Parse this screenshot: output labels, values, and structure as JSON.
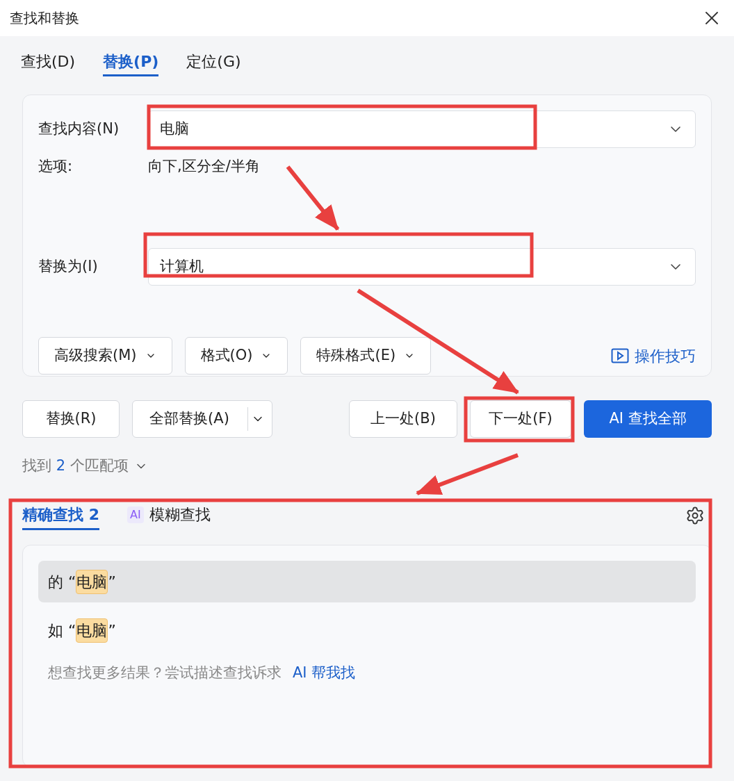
{
  "window": {
    "title": "查找和替换"
  },
  "tabs": [
    {
      "label": "查找(D)",
      "selected": false
    },
    {
      "label": "替换(P)",
      "selected": true
    },
    {
      "label": "定位(G)",
      "selected": false
    }
  ],
  "find": {
    "label": "查找内容(N)",
    "value": "电脑"
  },
  "options": {
    "label": "选项:",
    "value": "向下,区分全/半角"
  },
  "replace": {
    "label": "替换为(I)",
    "value": "计算机"
  },
  "option_buttons": [
    "高级搜索(M)",
    "格式(O)",
    "特殊格式(E)"
  ],
  "tips_link": "操作技巧",
  "actions": {
    "replace": "替换(R)",
    "replace_all": "全部替换(A)",
    "previous": "上一处(B)",
    "next": "下一处(F)",
    "find_all": "AI 查找全部"
  },
  "match_summary": {
    "before": "找到",
    "count": "2",
    "after": "个匹配项"
  },
  "result_tabs": [
    {
      "label": "精确查找",
      "count": "2",
      "selected": true
    },
    {
      "label": "模糊查找",
      "badge": "AI",
      "selected": false
    }
  ],
  "results": [
    {
      "before": "的 “",
      "match": "电脑",
      "after": "”",
      "selected": true
    },
    {
      "before": "如 “",
      "match": "电脑",
      "after": "”",
      "selected": false
    }
  ],
  "hint": {
    "text": "想查找更多结果？尝试描述查找诉求",
    "link": "AI 帮我找"
  }
}
